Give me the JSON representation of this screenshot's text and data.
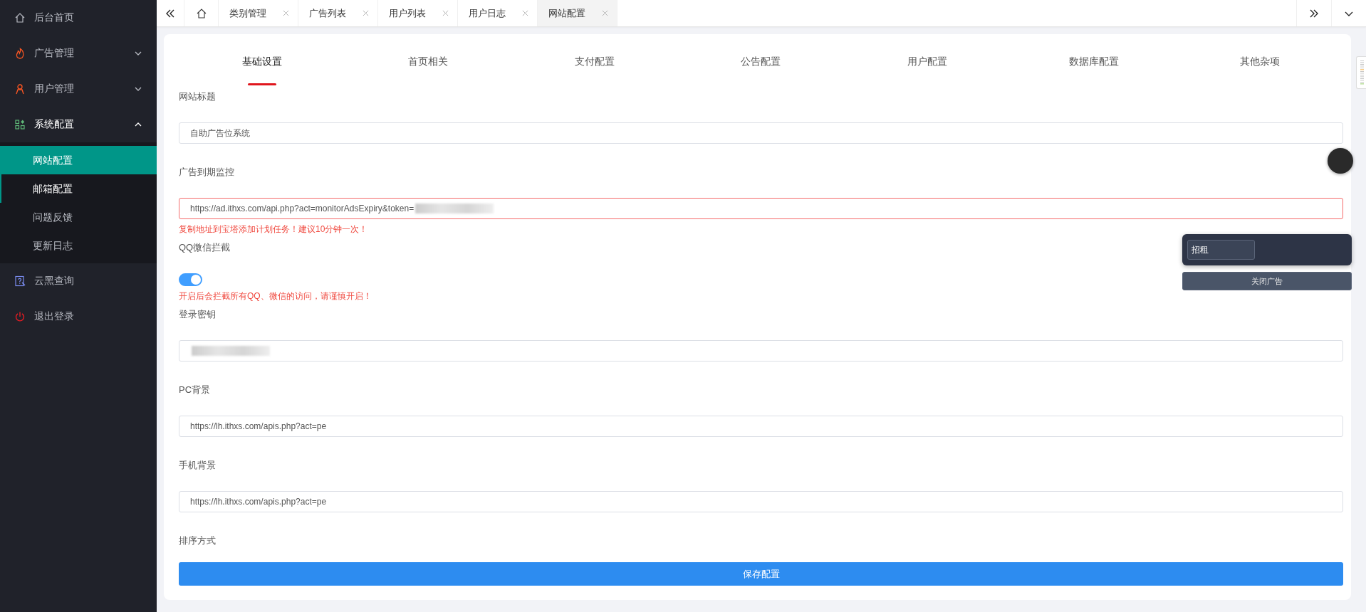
{
  "sidebar": {
    "items": [
      {
        "kind": "link",
        "label": "后台首页"
      },
      {
        "kind": "group",
        "label": "广告管理",
        "expanded": false
      },
      {
        "kind": "group",
        "label": "用户管理",
        "expanded": false
      },
      {
        "kind": "group",
        "label": "系统配置",
        "expanded": true,
        "children": [
          {
            "label": "网站配置",
            "selected": true,
            "hovered": false
          },
          {
            "label": "邮箱配置",
            "selected": false,
            "hovered": true
          },
          {
            "label": "问题反馈",
            "selected": false,
            "hovered": false
          },
          {
            "label": "更新日志",
            "selected": false,
            "hovered": false
          }
        ]
      },
      {
        "kind": "link",
        "label": "云黑查询"
      },
      {
        "kind": "link",
        "label": "退出登录"
      }
    ]
  },
  "page_tabs": [
    {
      "label": "类别管理",
      "selected": false
    },
    {
      "label": "广告列表",
      "selected": false
    },
    {
      "label": "用户列表",
      "selected": false
    },
    {
      "label": "用户日志",
      "selected": false
    },
    {
      "label": "网站配置",
      "selected": true
    }
  ],
  "section_tabs": [
    {
      "label": "基础设置",
      "selected": true
    },
    {
      "label": "首页相关",
      "selected": false
    },
    {
      "label": "支付配置",
      "selected": false
    },
    {
      "label": "公告配置",
      "selected": false
    },
    {
      "label": "用户配置",
      "selected": false
    },
    {
      "label": "数据库配置",
      "selected": false
    },
    {
      "label": "其他杂项",
      "selected": false
    }
  ],
  "form": [
    {
      "kind": "text",
      "label": "网站标题",
      "value": "自助广告位系统",
      "error": false,
      "redacted": false
    },
    {
      "kind": "text",
      "label": "广告到期监控",
      "value": "https://ad.ithxs.com/api.php?act=monitorAdsExpiry&token=",
      "error": true,
      "redacted": true,
      "hint": "复制地址到宝塔添加计划任务！建议10分钟一次！"
    },
    {
      "kind": "switch",
      "label": "QQ微信拦截",
      "on": true,
      "hint": "开启后会拦截所有QQ、微信的访问，请谨慎开启！"
    },
    {
      "kind": "text",
      "label": "登录密钥",
      "error": false,
      "redacted": true
    },
    {
      "kind": "text",
      "label": "PC背景",
      "value": "https://lh.ithxs.com/apis.php?act=pe",
      "error": false,
      "redacted": false
    },
    {
      "kind": "text",
      "label": "手机背景",
      "value": "https://lh.ithxs.com/apis.php?act=pe",
      "error": false,
      "redacted": false
    },
    {
      "kind": "heading",
      "label": "排序方式"
    }
  ],
  "save_button": "保存配置",
  "ad_widget": {
    "input": "招租",
    "close_button": "关闭广告"
  }
}
